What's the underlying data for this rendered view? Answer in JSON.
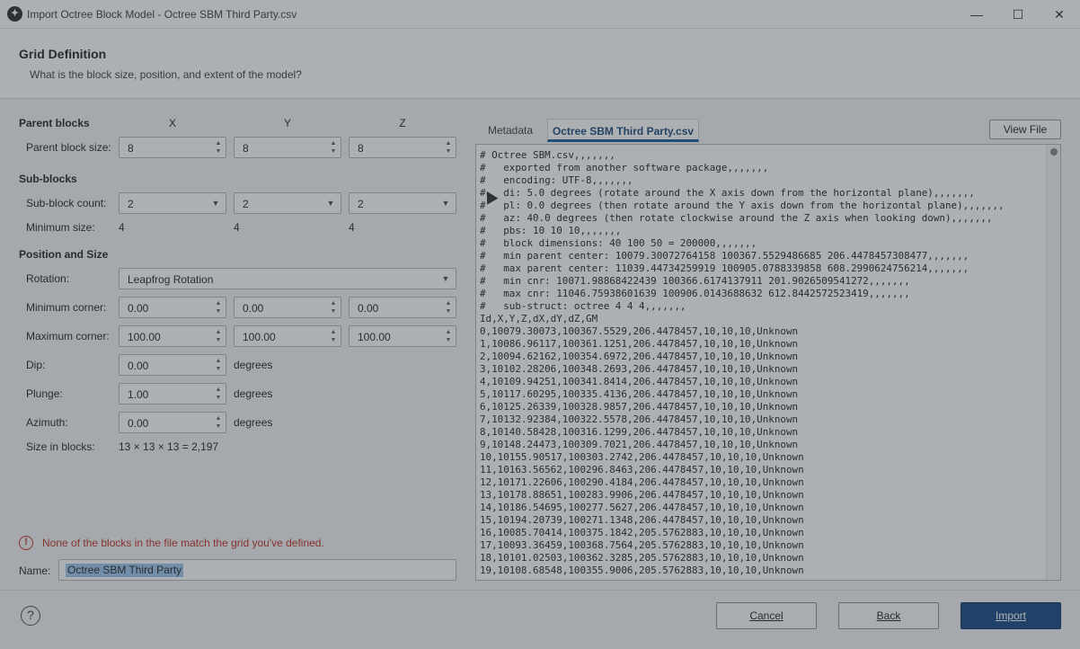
{
  "window": {
    "title": "Import Octree Block Model - Octree SBM Third Party.csv",
    "app_icon": "leapfrog-logo-icon",
    "controls": [
      "minimize-icon",
      "maximize-icon",
      "close-icon"
    ]
  },
  "header": {
    "title": "Grid Definition",
    "subtitle": "What is the block size, position, and extent of the model?"
  },
  "parent_blocks": {
    "title": "Parent blocks",
    "col_x": "X",
    "col_y": "Y",
    "col_z": "Z",
    "size_label": "Parent block size:",
    "size_x": "8",
    "size_y": "8",
    "size_z": "8"
  },
  "sub_blocks": {
    "title": "Sub-blocks",
    "count_label": "Sub-block count:",
    "count_x": "2",
    "count_y": "2",
    "count_z": "2",
    "min_size_label": "Minimum size:",
    "min_x": "4",
    "min_y": "4",
    "min_z": "4"
  },
  "position": {
    "title": "Position and Size",
    "rotation_label": "Rotation:",
    "rotation_value": "Leapfrog Rotation",
    "min_corner_label": "Minimum corner:",
    "min_x": "0.00",
    "min_y": "0.00",
    "min_z": "0.00",
    "max_corner_label": "Maximum corner:",
    "max_x": "100.00",
    "max_y": "100.00",
    "max_z": "100.00",
    "dip_label": "Dip:",
    "dip_value": "0.00",
    "plunge_label": "Plunge:",
    "plunge_value": "1.00",
    "azimuth_label": "Azimuth:",
    "azimuth_value": "0.00",
    "degrees": "degrees",
    "size_in_blocks_label": "Size in blocks:",
    "size_in_blocks_value": "13 × 13 × 13 = 2,197"
  },
  "warning": {
    "icon": "error-circle-icon",
    "text": "None of the blocks in the file match the grid you've defined."
  },
  "name_field": {
    "label": "Name:",
    "value": "Octree SBM Third Party"
  },
  "tabs": {
    "metadata": "Metadata",
    "file": "Octree SBM Third Party.csv",
    "view_file": "View File"
  },
  "file_lines": [
    "# Octree SBM.csv,,,,,,,",
    "#   exported from another software package,,,,,,,",
    "#   encoding: UTF-8,,,,,,,",
    "#   di: 5.0 degrees (rotate around the X axis down from the horizontal plane),,,,,,,",
    "#   pl: 0.0 degrees (then rotate around the Y axis down from the horizontal plane),,,,,,,",
    "#   az: 40.0 degrees (then rotate clockwise around the Z axis when looking down),,,,,,,",
    "#   pbs: 10 10 10,,,,,,,",
    "#   block dimensions: 40 100 50 = 200000,,,,,,,",
    "#   min parent center: 10079.30072764158 100367.5529486685 206.4478457308477,,,,,,,",
    "#   max parent center: 11039.44734259919 100905.0788339858 608.2990624756214,,,,,,,",
    "#   min cnr: 10071.98868422439 100366.6174137911 201.9026509541272,,,,,,,",
    "#   max cnr: 11046.75938601639 100906.0143688632 612.8442572523419,,,,,,,",
    "#   sub-struct: octree 4 4 4,,,,,,,",
    "Id,X,Y,Z,dX,dY,dZ,GM",
    "0,10079.30073,100367.5529,206.4478457,10,10,10,Unknown",
    "1,10086.96117,100361.1251,206.4478457,10,10,10,Unknown",
    "2,10094.62162,100354.6972,206.4478457,10,10,10,Unknown",
    "3,10102.28206,100348.2693,206.4478457,10,10,10,Unknown",
    "4,10109.94251,100341.8414,206.4478457,10,10,10,Unknown",
    "5,10117.60295,100335.4136,206.4478457,10,10,10,Unknown",
    "6,10125.26339,100328.9857,206.4478457,10,10,10,Unknown",
    "7,10132.92384,100322.5578,206.4478457,10,10,10,Unknown",
    "8,10140.58428,100316.1299,206.4478457,10,10,10,Unknown",
    "9,10148.24473,100309.7021,206.4478457,10,10,10,Unknown",
    "10,10155.90517,100303.2742,206.4478457,10,10,10,Unknown",
    "11,10163.56562,100296.8463,206.4478457,10,10,10,Unknown",
    "12,10171.22606,100290.4184,206.4478457,10,10,10,Unknown",
    "13,10178.88651,100283.9906,206.4478457,10,10,10,Unknown",
    "14,10186.54695,100277.5627,206.4478457,10,10,10,Unknown",
    "15,10194.20739,100271.1348,206.4478457,10,10,10,Unknown",
    "16,10085.70414,100375.1842,205.5762883,10,10,10,Unknown",
    "17,10093.36459,100368.7564,205.5762883,10,10,10,Unknown",
    "18,10101.02503,100362.3285,205.5762883,10,10,10,Unknown",
    "19,10108.68548,100355.9006,205.5762883,10,10,10,Unknown"
  ],
  "buttons": {
    "help": "?",
    "cancel": "Cancel",
    "back": "Back",
    "import": "Import"
  }
}
